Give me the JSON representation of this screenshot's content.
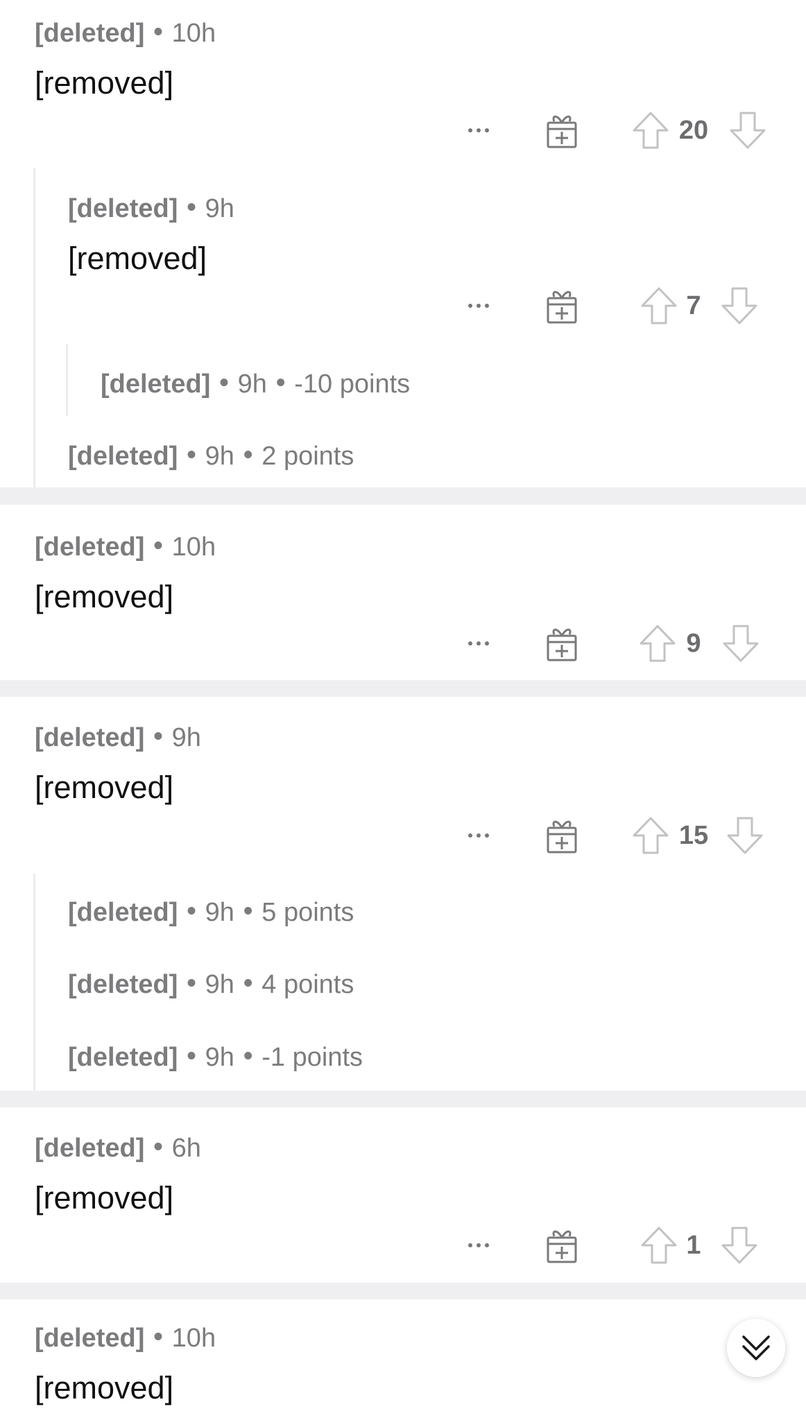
{
  "separator_dot": "•",
  "comments": [
    {
      "author": "[deleted]",
      "time": "10h",
      "body": "[removed]",
      "score": "20",
      "replies": [
        {
          "author": "[deleted]",
          "time": "9h",
          "body": "[removed]",
          "score": "7",
          "collapsed_replies": [
            {
              "author": "[deleted]",
              "time": "9h",
              "points": "-10 points"
            }
          ]
        }
      ],
      "collapsed_replies": [
        {
          "author": "[deleted]",
          "time": "9h",
          "points": "2 points"
        }
      ]
    },
    {
      "author": "[deleted]",
      "time": "10h",
      "body": "[removed]",
      "score": "9"
    },
    {
      "author": "[deleted]",
      "time": "9h",
      "body": "[removed]",
      "score": "15",
      "collapsed_replies": [
        {
          "author": "[deleted]",
          "time": "9h",
          "points": "5 points"
        },
        {
          "author": "[deleted]",
          "time": "9h",
          "points": "4 points"
        },
        {
          "author": "[deleted]",
          "time": "9h",
          "points": "-1 points"
        }
      ]
    },
    {
      "author": "[deleted]",
      "time": "6h",
      "body": "[removed]",
      "score": "1"
    },
    {
      "author": "[deleted]",
      "time": "10h",
      "body": "[removed]"
    }
  ],
  "icons": {
    "more": "more-options-icon",
    "award": "gift-award-icon",
    "upvote": "upvote-arrow-icon",
    "downvote": "downvote-arrow-icon",
    "jump": "double-chevron-down-icon"
  },
  "colors": {
    "separator": "#efeff1",
    "thread_line": "#ececee",
    "meta_text": "#7c7c7e",
    "icon_stroke": "#8a8a8d"
  }
}
